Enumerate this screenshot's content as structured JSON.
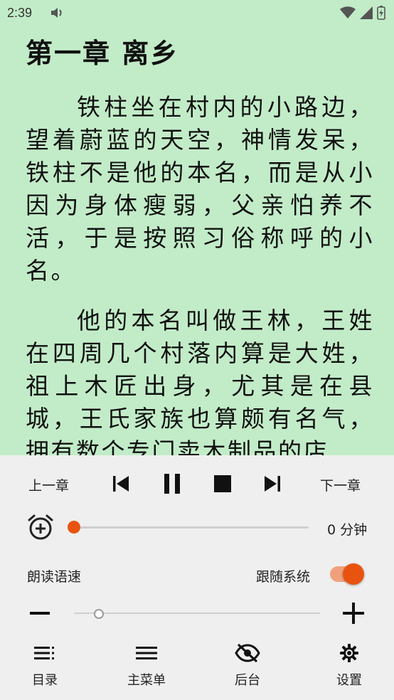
{
  "status_bar": {
    "time": "2:39"
  },
  "reader": {
    "chapter_title": "第一章 离乡",
    "paragraphs": [
      "铁柱坐在村内的小路边，望着蔚蓝的天空，神情发呆，铁柱不是他的本名，而是从小因为身体瘦弱，父亲怕养不活，于是按照习俗称呼的小名。",
      "他的本名叫做王林，王姓在四周几个村落内算是大姓，祖上木匠出身，尤其是在县城，王氏家族也算颇有名气，拥有数个专门卖木制品的店"
    ]
  },
  "controls": {
    "prev_chapter": "上一章",
    "next_chapter": "下一章",
    "timer_value": "0 分钟",
    "timer_fraction": 0.0,
    "speech_rate_label": "朗读语速",
    "follow_system_label": "跟随系统",
    "follow_system_on": true,
    "speech_rate_fraction": 0.1,
    "accent_color": "#e85410"
  },
  "bottom_nav": [
    {
      "label": "目录",
      "icon": "toc-icon"
    },
    {
      "label": "主菜单",
      "icon": "menu-icon"
    },
    {
      "label": "后台",
      "icon": "eye-off-icon"
    },
    {
      "label": "设置",
      "icon": "gear-icon"
    }
  ]
}
